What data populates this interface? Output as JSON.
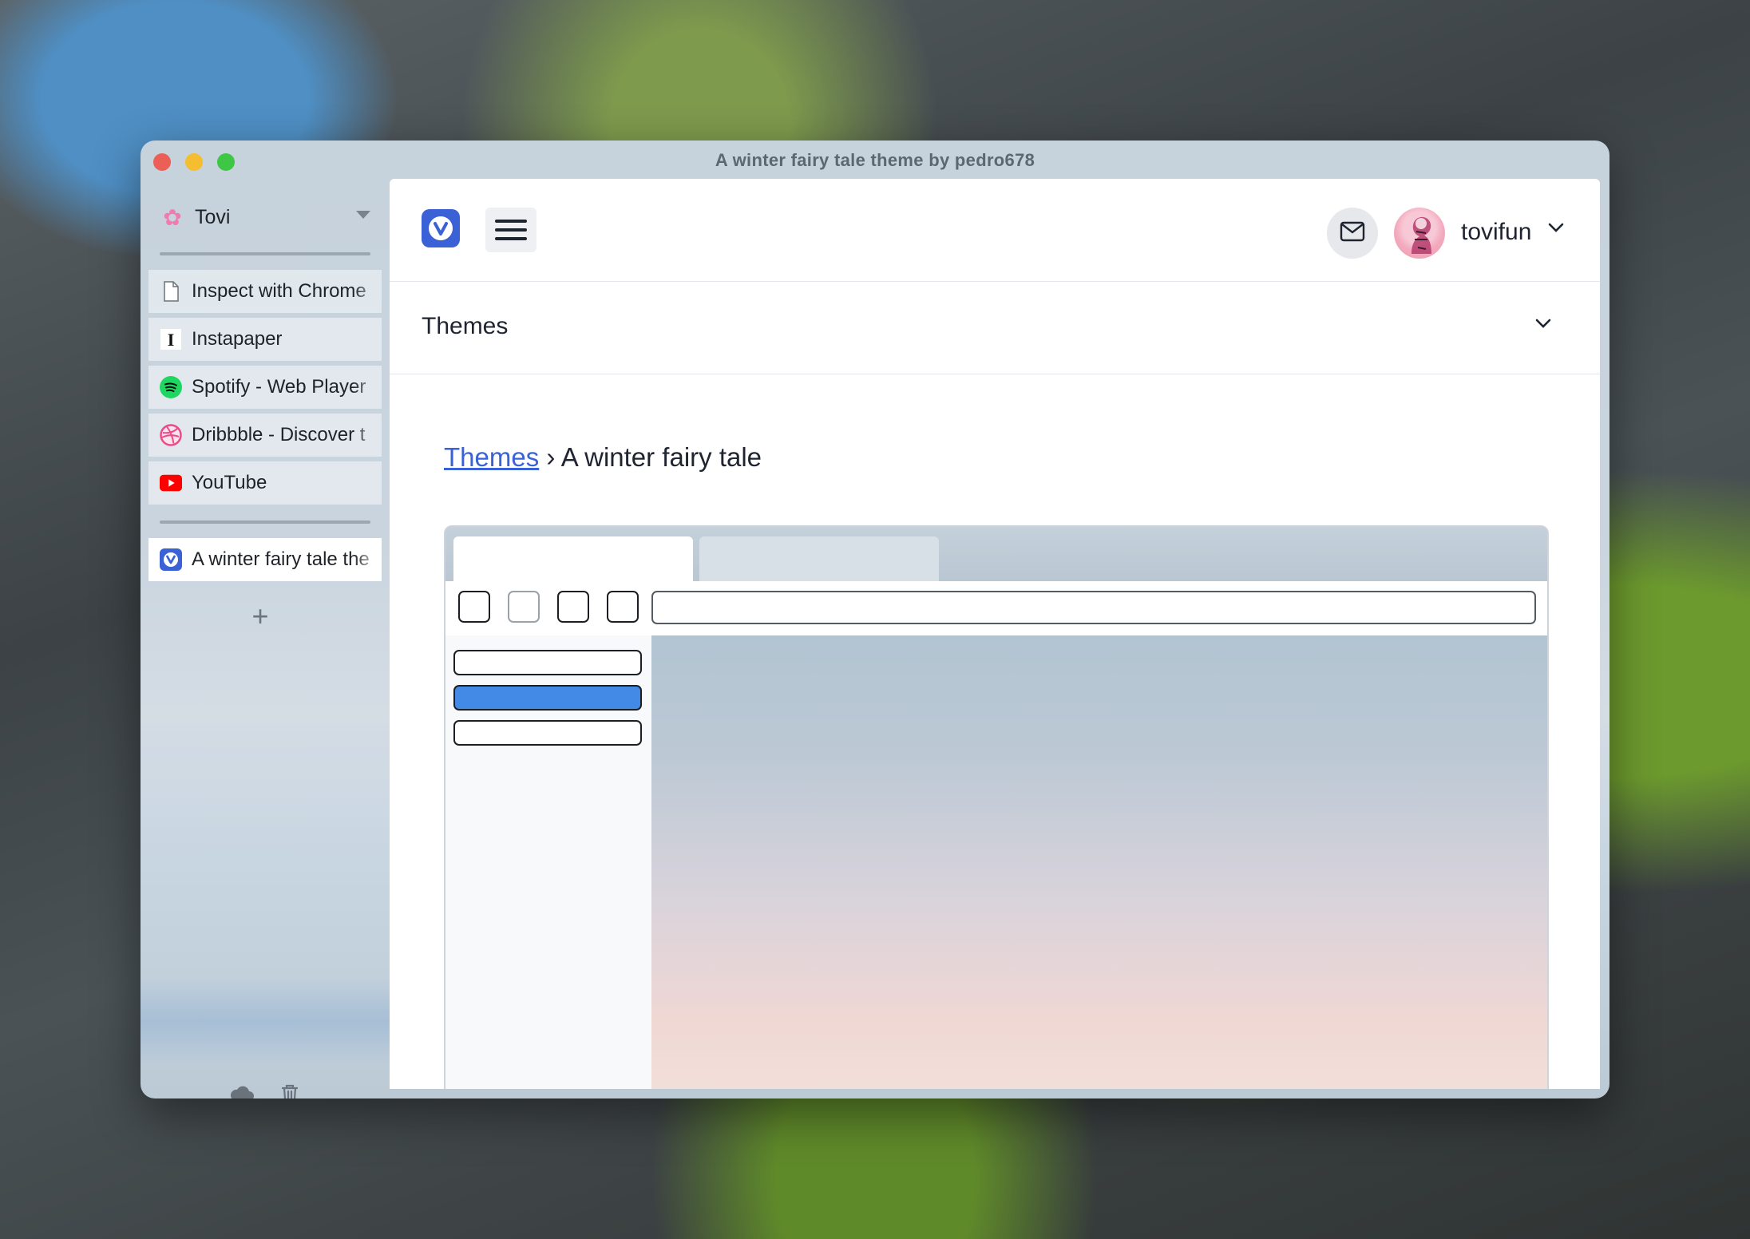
{
  "window": {
    "title": "A winter fairy tale theme by pedro678"
  },
  "sidebar": {
    "profile_name": "Tovi",
    "pinned_tabs": [
      {
        "label": "Inspect with Chrome",
        "icon": "document-icon"
      },
      {
        "label": "Instapaper",
        "icon": "instapaper-icon"
      },
      {
        "label": "Spotify - Web Player",
        "icon": "spotify-icon"
      },
      {
        "label": "Dribbble - Discover t",
        "icon": "dribbble-icon"
      },
      {
        "label": "YouTube",
        "icon": "youtube-icon"
      }
    ],
    "active_tab": {
      "label": "A winter fairy tale the",
      "icon": "vivaldi-icon"
    },
    "add_tab_label": "+"
  },
  "page": {
    "username": "tovifun",
    "section_title": "Themes",
    "breadcrumb": {
      "link": "Themes",
      "separator": "›",
      "current": "A winter fairy tale"
    }
  },
  "colors": {
    "accent": "#3a62d6",
    "preview_selected": "#438ae6"
  }
}
